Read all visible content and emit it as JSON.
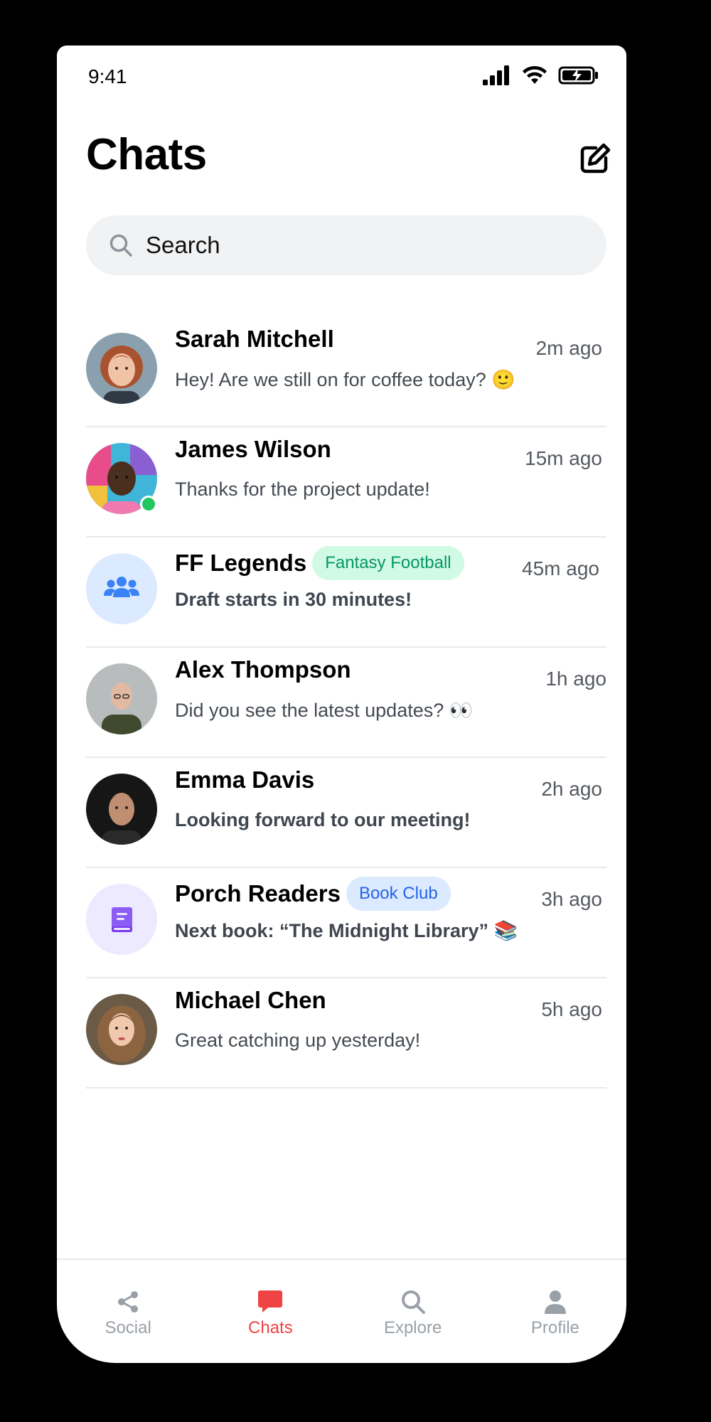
{
  "status_bar": {
    "time": "9:41"
  },
  "header": {
    "title": "Chats"
  },
  "search": {
    "placeholder": "Search"
  },
  "colors": {
    "accent": "#ef4444",
    "online": "#22c55e"
  },
  "chats": [
    {
      "name": "Sarah Mitchell",
      "time": "2m ago",
      "preview": "Hey! Are we still on for coffee today? 🙂",
      "avatar": "photo-woman-red-hair"
    },
    {
      "name": "James Wilson",
      "time": "15m ago",
      "preview": "Thanks for the project update!",
      "avatar": "photo-man-colorful-background",
      "online": true
    },
    {
      "name": "FF Legends",
      "tag": "Fantasy Football",
      "time": "45m ago",
      "preview": "Draft starts in 30 minutes!",
      "avatar": "group-icon"
    },
    {
      "name": "Alex Thompson",
      "time": "1h ago",
      "preview": "Did you see the latest updates? 👀",
      "avatar": "photo-bald-man-glasses"
    },
    {
      "name": "Emma Davis",
      "time": "2h ago",
      "preview": "Looking forward to our meeting!",
      "avatar": "photo-man-dark-background"
    },
    {
      "name": "Porch Readers",
      "tag": "Book Club",
      "time": "3h ago",
      "preview": "Next book: “The Midnight Library” 📚",
      "avatar": "book-icon"
    },
    {
      "name": "Michael Chen",
      "time": "5h ago",
      "preview": "Great catching up yesterday!",
      "avatar": "photo-woman-long-hair"
    }
  ],
  "nav": [
    {
      "label": "Social",
      "icon": "share-icon"
    },
    {
      "label": "Chats",
      "icon": "chat-bubble-icon",
      "active": true
    },
    {
      "label": "Explore",
      "icon": "search-icon"
    },
    {
      "label": "Profile",
      "icon": "person-icon"
    }
  ]
}
